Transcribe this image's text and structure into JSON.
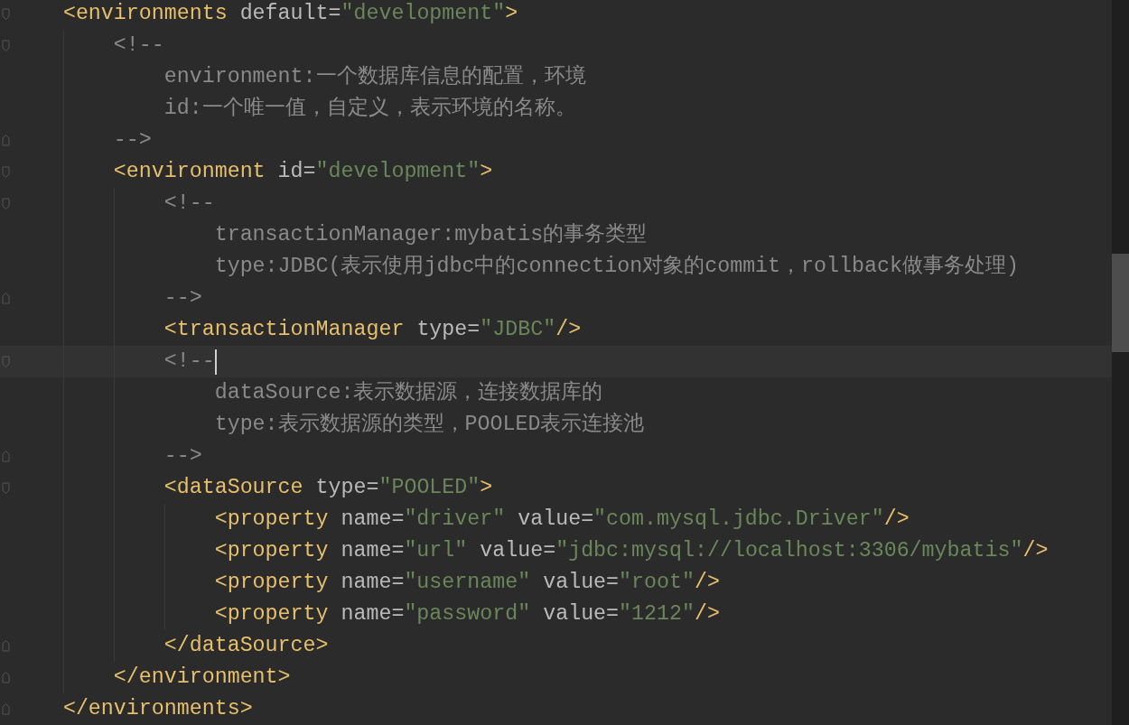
{
  "editor": {
    "lines": [
      {
        "kind": "code",
        "fold_start": true,
        "fold_end": false,
        "current": false,
        "tokens": [
          {
            "kind": "tag",
            "text": "<environments"
          },
          {
            "kind": "attr",
            "text": "default"
          },
          {
            "kind": "eq",
            "text": "="
          },
          {
            "kind": "value",
            "text": "\"development\""
          },
          {
            "kind": "tag",
            "text": ">"
          }
        ]
      },
      {
        "kind": "code",
        "fold_start": true,
        "fold_end": false,
        "current": false,
        "tokens": [
          {
            "kind": "comment",
            "text": "<!--"
          }
        ]
      },
      {
        "kind": "comment",
        "fold_start": false,
        "fold_end": false,
        "current": false,
        "tokens": [
          {
            "kind": "comment",
            "text": "environment:一个数据库信息的配置，环境"
          }
        ]
      },
      {
        "kind": "comment",
        "fold_start": false,
        "fold_end": false,
        "current": false,
        "tokens": [
          {
            "kind": "comment",
            "text": "id:一个唯一值，自定义，表示环境的名称。"
          }
        ]
      },
      {
        "kind": "code",
        "fold_start": false,
        "fold_end": true,
        "current": false,
        "tokens": [
          {
            "kind": "comment",
            "text": "-->"
          }
        ]
      },
      {
        "kind": "code",
        "fold_start": true,
        "fold_end": false,
        "current": false,
        "tokens": [
          {
            "kind": "tag",
            "text": "<environment"
          },
          {
            "kind": "attr",
            "text": "id"
          },
          {
            "kind": "eq",
            "text": "="
          },
          {
            "kind": "value",
            "text": "\"development\""
          },
          {
            "kind": "tag",
            "text": ">"
          }
        ]
      },
      {
        "kind": "code",
        "fold_start": true,
        "fold_end": false,
        "current": false,
        "tokens": [
          {
            "kind": "comment",
            "text": "<!--"
          }
        ]
      },
      {
        "kind": "comment",
        "fold_start": false,
        "fold_end": false,
        "current": false,
        "tokens": [
          {
            "kind": "comment",
            "text": "transactionManager:mybatis的事务类型"
          }
        ]
      },
      {
        "kind": "comment",
        "fold_start": false,
        "fold_end": false,
        "current": false,
        "tokens": [
          {
            "kind": "comment",
            "text": "type:JDBC(表示使用jdbc中的connection对象的commit，rollback做事务处理)"
          }
        ]
      },
      {
        "kind": "code",
        "fold_start": false,
        "fold_end": true,
        "current": false,
        "tokens": [
          {
            "kind": "comment",
            "text": "-->"
          }
        ]
      },
      {
        "kind": "code",
        "fold_start": false,
        "fold_end": false,
        "current": false,
        "tokens": [
          {
            "kind": "tag",
            "text": "<transactionManager"
          },
          {
            "kind": "attr",
            "text": "type"
          },
          {
            "kind": "eq",
            "text": "="
          },
          {
            "kind": "value",
            "text": "\"JDBC\""
          },
          {
            "kind": "tag",
            "text": "/>"
          }
        ]
      },
      {
        "kind": "code",
        "fold_start": true,
        "fold_end": false,
        "current": true,
        "tokens": [
          {
            "kind": "comment",
            "text": "<!--"
          }
        ]
      },
      {
        "kind": "comment",
        "fold_start": false,
        "fold_end": false,
        "current": false,
        "tokens": [
          {
            "kind": "comment",
            "text": "dataSource:表示数据源，连接数据库的"
          }
        ]
      },
      {
        "kind": "comment",
        "fold_start": false,
        "fold_end": false,
        "current": false,
        "tokens": [
          {
            "kind": "comment",
            "text": "type:表示数据源的类型，POOLED表示连接池"
          }
        ]
      },
      {
        "kind": "code",
        "fold_start": false,
        "fold_end": true,
        "current": false,
        "tokens": [
          {
            "kind": "comment",
            "text": "-->"
          }
        ]
      },
      {
        "kind": "code",
        "fold_start": true,
        "fold_end": false,
        "current": false,
        "tokens": [
          {
            "kind": "tag",
            "text": "<dataSource"
          },
          {
            "kind": "attr",
            "text": "type"
          },
          {
            "kind": "eq",
            "text": "="
          },
          {
            "kind": "value",
            "text": "\"POOLED\""
          },
          {
            "kind": "tag",
            "text": ">"
          }
        ]
      },
      {
        "kind": "code",
        "fold_start": false,
        "fold_end": false,
        "current": false,
        "tokens": [
          {
            "kind": "tag",
            "text": "<property"
          },
          {
            "kind": "attr",
            "text": "name"
          },
          {
            "kind": "eq",
            "text": "="
          },
          {
            "kind": "value",
            "text": "\"driver\""
          },
          {
            "kind": "attr",
            "text": "value"
          },
          {
            "kind": "eq",
            "text": "="
          },
          {
            "kind": "value",
            "text": "\"com.mysql.jdbc.Driver\""
          },
          {
            "kind": "tag",
            "text": "/>"
          }
        ]
      },
      {
        "kind": "code",
        "fold_start": false,
        "fold_end": false,
        "current": false,
        "tokens": [
          {
            "kind": "tag",
            "text": "<property"
          },
          {
            "kind": "attr",
            "text": "name"
          },
          {
            "kind": "eq",
            "text": "="
          },
          {
            "kind": "value",
            "text": "\"url\""
          },
          {
            "kind": "attr",
            "text": "value"
          },
          {
            "kind": "eq",
            "text": "="
          },
          {
            "kind": "value",
            "text": "\"jdbc:mysql://localhost:3306/mybatis\""
          },
          {
            "kind": "tag",
            "text": "/>"
          }
        ]
      },
      {
        "kind": "code",
        "fold_start": false,
        "fold_end": false,
        "current": false,
        "tokens": [
          {
            "kind": "tag",
            "text": "<property"
          },
          {
            "kind": "attr",
            "text": "name"
          },
          {
            "kind": "eq",
            "text": "="
          },
          {
            "kind": "value",
            "text": "\"username\""
          },
          {
            "kind": "attr",
            "text": "value"
          },
          {
            "kind": "eq",
            "text": "="
          },
          {
            "kind": "value",
            "text": "\"root\""
          },
          {
            "kind": "tag",
            "text": "/>"
          }
        ]
      },
      {
        "kind": "code",
        "fold_start": false,
        "fold_end": false,
        "current": false,
        "tokens": [
          {
            "kind": "tag",
            "text": "<property"
          },
          {
            "kind": "attr",
            "text": "name"
          },
          {
            "kind": "eq",
            "text": "="
          },
          {
            "kind": "value",
            "text": "\"password\""
          },
          {
            "kind": "attr",
            "text": "value"
          },
          {
            "kind": "eq",
            "text": "="
          },
          {
            "kind": "value",
            "text": "\"1212\""
          },
          {
            "kind": "tag",
            "text": "/>"
          }
        ]
      },
      {
        "kind": "code",
        "fold_start": false,
        "fold_end": true,
        "current": false,
        "tokens": [
          {
            "kind": "tag",
            "text": "</dataSource>"
          }
        ]
      },
      {
        "kind": "code",
        "fold_start": false,
        "fold_end": true,
        "current": false,
        "tokens": [
          {
            "kind": "tag",
            "text": "</environment>"
          }
        ]
      },
      {
        "kind": "code",
        "fold_start": false,
        "fold_end": true,
        "current": false,
        "tokens": [
          {
            "kind": "tag",
            "text": "</environments>"
          }
        ]
      }
    ]
  }
}
